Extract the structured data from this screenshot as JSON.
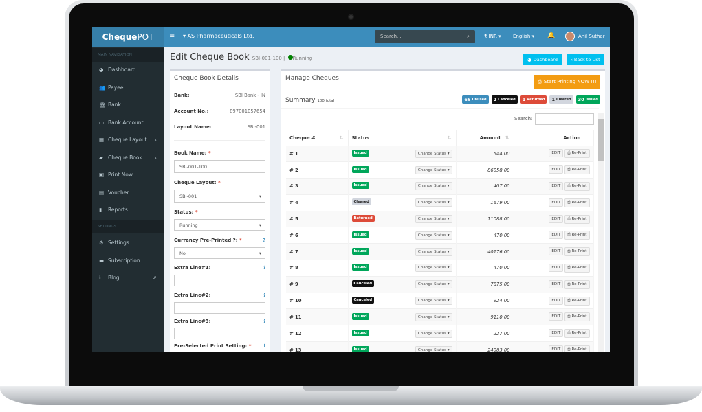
{
  "app": {
    "logo_bold": "Cheque",
    "logo_rest": "POT",
    "company": "AS Pharmaceuticals Ltd.",
    "search_placeholder": "Search...",
    "currency": "₹ INR",
    "language": "English",
    "user": "Anil Suthar"
  },
  "sidebar": {
    "main_header": "MAIN NAVIGATION",
    "settings_header": "SETTINGS",
    "items": [
      {
        "label": "Dashboard",
        "icon": "dashboard-icon",
        "glyph": "◕"
      },
      {
        "label": "Payee",
        "icon": "users-icon",
        "glyph": "👥"
      },
      {
        "label": "Bank",
        "icon": "bank-icon",
        "glyph": "🏛"
      },
      {
        "label": "Bank Account",
        "icon": "id-card-icon",
        "glyph": "▭"
      },
      {
        "label": "Cheque Layout",
        "icon": "layout-icon",
        "glyph": "▦",
        "caret": "‹"
      },
      {
        "label": "Cheque Book",
        "icon": "book-icon",
        "glyph": "▰",
        "caret": "‹"
      },
      {
        "label": "Print Now",
        "icon": "money-icon",
        "glyph": "▣"
      },
      {
        "label": "Voucher",
        "icon": "voucher-icon",
        "glyph": "▤"
      },
      {
        "label": "Reports",
        "icon": "file-icon",
        "glyph": "▮"
      }
    ],
    "settings_items": [
      {
        "label": "Settings",
        "icon": "gear-icon",
        "glyph": "⚙"
      },
      {
        "label": "Subscription",
        "icon": "credit-card-icon",
        "glyph": "▬"
      },
      {
        "label": "Blog",
        "icon": "info-icon",
        "glyph": "ℹ",
        "caret": "↗"
      }
    ]
  },
  "page": {
    "title": "Edit Cheque Book",
    "subtitle": "SBI-001-100 |",
    "status": "Running",
    "status_color": "#008000",
    "dashboard_btn": "Dashboard",
    "back_btn": "‹ Back to List"
  },
  "details": {
    "title": "Cheque Book Details",
    "bank_label": "Bank:",
    "bank": "SBI Bank - IN",
    "account_label": "Account No.:",
    "account": "897001057654",
    "layout_label": "Layout Name:",
    "layout": "SBI-001",
    "book_name_label": "Book Name:",
    "book_name": "SBI-001-100",
    "cheque_layout_label": "Cheque Layout:",
    "cheque_layout": "SBI-001",
    "status_label": "Status:",
    "status": "Running",
    "currency_label": "Currency Pre-Printed ?:",
    "currency": "No",
    "extra1_label": "Extra Line#1:",
    "extra2_label": "Extra Line#2:",
    "extra3_label": "Extra Line#3:",
    "preselected_label": "Pre-Selected Print Setting:"
  },
  "manage": {
    "title": "Manage Cheques",
    "print_btn": "Start Printing NOW !!!",
    "summary": "Summary",
    "total": "100 total",
    "search_label": "Search:",
    "badges": [
      {
        "count": "66",
        "label": "Unused",
        "color": "#3c8dbc"
      },
      {
        "count": "2",
        "label": "Canceled",
        "color": "#111111"
      },
      {
        "count": "1",
        "label": "Returned",
        "color": "#dd4b39"
      },
      {
        "count": "1",
        "label": "Cleared",
        "color": "#d2d6de"
      },
      {
        "count": "30",
        "label": "Issued",
        "color": "#00a65a"
      }
    ],
    "columns": [
      "Cheque #",
      "Status",
      "Amount",
      "Action"
    ],
    "change_status": "Change Status ▾",
    "edit": "EDIT",
    "reprint": "⎙ Re-Print",
    "rows": [
      [
        "# 1",
        "Issued",
        "544.00"
      ],
      [
        "# 2",
        "Issued",
        "86058.00"
      ],
      [
        "# 3",
        "Issued",
        "407.00"
      ],
      [
        "# 4",
        "Cleared",
        "1679.00"
      ],
      [
        "# 5",
        "Returned",
        "11088.00"
      ],
      [
        "# 6",
        "Issued",
        "470.00"
      ],
      [
        "# 7",
        "Issued",
        "40176.00"
      ],
      [
        "# 8",
        "Issued",
        "470.00"
      ],
      [
        "# 9",
        "Canceled",
        "7875.00"
      ],
      [
        "# 10",
        "Canceled",
        "924.00"
      ],
      [
        "# 11",
        "Issued",
        "9110.00"
      ],
      [
        "# 12",
        "Issued",
        "227.00"
      ],
      [
        "# 13",
        "Issued",
        "24983.00"
      ]
    ]
  }
}
